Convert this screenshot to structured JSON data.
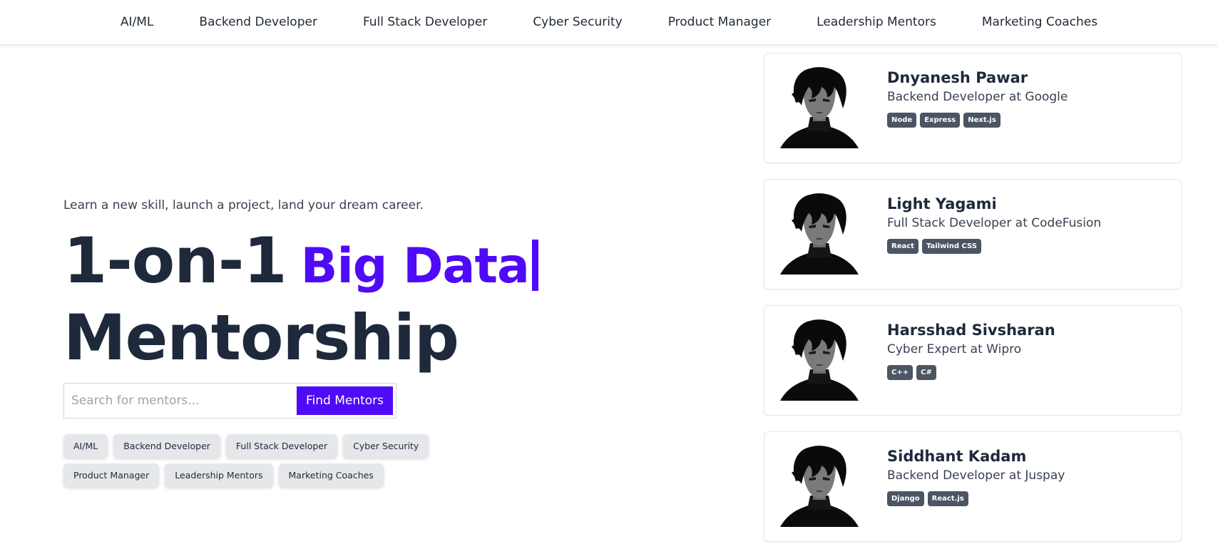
{
  "nav": {
    "items": [
      "AI/ML",
      "Backend Developer",
      "Full Stack Developer",
      "Cyber Security",
      "Product Manager",
      "Leadership Mentors",
      "Marketing Coaches"
    ]
  },
  "hero": {
    "tagline": "Learn a new skill, launch a project, land your dream career.",
    "headline_part1": "1-on-1",
    "typed_text": "Big Data",
    "headline_part2": "Mentorship",
    "search_placeholder": "Search for mentors...",
    "search_value": "",
    "search_button": "Find Mentors"
  },
  "categories": [
    "AI/ML",
    "Backend Developer",
    "Full Stack Developer",
    "Cyber Security",
    "Product Manager",
    "Leadership Mentors",
    "Marketing Coaches"
  ],
  "mentors": [
    {
      "name": "Dnyanesh Pawar",
      "role": "Backend Developer at Google",
      "tags": [
        "Node",
        "Express",
        "Next.js"
      ]
    },
    {
      "name": "Light Yagami",
      "role": "Full Stack Developer at CodeFusion",
      "tags": [
        "React",
        "Tailwind CSS"
      ]
    },
    {
      "name": "Harsshad Sivsharan",
      "role": "Cyber Expert at Wipro",
      "tags": [
        "C++",
        "C#"
      ]
    },
    {
      "name": "Siddhant Kadam",
      "role": "Backend Developer at Juspay",
      "tags": [
        "Django",
        "React.js"
      ]
    }
  ],
  "colors": {
    "accent": "#4f0af7",
    "heading": "#1e293b",
    "tag_bg": "#4b5563",
    "chip_bg": "#e5e7eb"
  },
  "icons": {
    "avatar": "avatar-portrait-icon"
  }
}
